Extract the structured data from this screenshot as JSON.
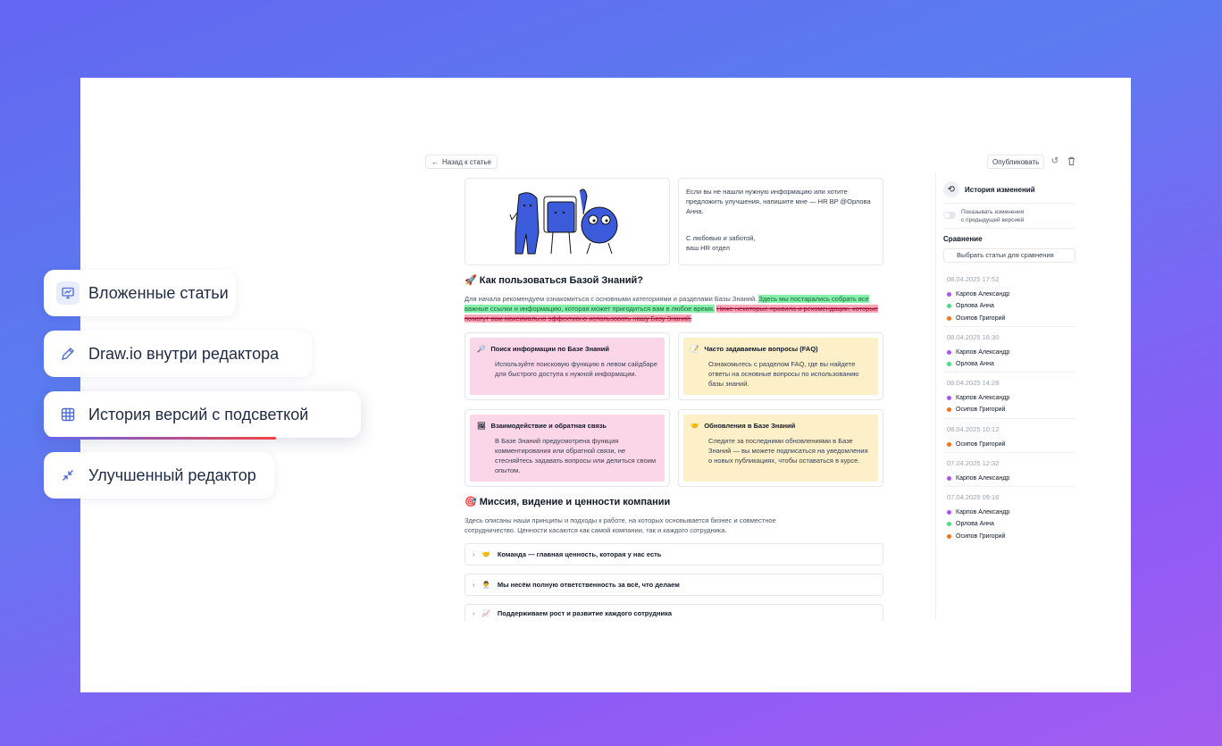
{
  "features": [
    {
      "label": "Вложенные статьи",
      "icon": "presentation-chart-icon"
    },
    {
      "label": "Draw.io внутри редактора",
      "icon": "pencil-icon"
    },
    {
      "label": "История версий с подсветкой",
      "icon": "grid-icon"
    },
    {
      "label": "Улучшенный редактор",
      "icon": "arrows-collapse-icon"
    }
  ],
  "toolbar": {
    "back_label": "Назад к статье",
    "publish_label": "Опубликовать"
  },
  "intro_note": {
    "line1": "Если вы не нашли нужную информацию или хотите предложить улучшения, напишите мне — HR BP @Орлова Анна.",
    "line2": "С любовью и заботой,",
    "line3": "ваш HR отдел"
  },
  "section1": {
    "emoji": "🚀",
    "title": "Как пользоваться Базой Знаний?",
    "text_plain": "Для начала рекомендуем ознакомиться с основными категориями и разделами Базы Знаний.",
    "text_added": "Здесь мы постарались собрать все важные ссылки и информацию, которая может пригодиться вам в любое время.",
    "text_removed": "Ниже некоторые правила и рекомендации, которые помогут вам максимально эффективно использовать нашу Базу Знаний."
  },
  "cards": [
    {
      "emoji": "🔎",
      "title": "Поиск информации по Базе Знаний",
      "body": "Используйте поисковую функцию в левом сайдбаре для быстрого доступа к нужной информации."
    },
    {
      "emoji": "📝",
      "title": "Часто задаваемые вопросы (FAQ)",
      "body": "Ознакомьтесь с разделом FAQ, где вы найдете ответы на основные вопросы по использованию базы знаний."
    },
    {
      "emoji": "🖼",
      "title": "Взаимодействие и обратная связь",
      "body": "В Базе Знаний предусмотрена функция комментирования или обратной связи, не стесняйтесь задавать вопросы или делиться своим опытом."
    },
    {
      "emoji": "🤝",
      "title": "Обновления в Базе Знаний",
      "body": "Следите за последними обновлениями в Базе Знаний — вы можете подписаться на уведомления о новых публикациях, чтобы оставаться в курсе."
    }
  ],
  "section2": {
    "emoji": "🎯",
    "title": "Миссия, видение и ценности компании",
    "text": "Здесь описаны наши принципы и подходы к работе, на которых основывается бизнес и совместное сотрудничество. Ценности касаются как самой компании, так и каждого сотрудника."
  },
  "accordions": [
    {
      "emoji": "🤝",
      "label": "Команда — главная ценность, которая у нас есть"
    },
    {
      "emoji": "👨‍💼",
      "label": "Мы несём полную ответственность за всё, что делаем"
    },
    {
      "emoji": "📈",
      "label": "Поддерживаем рост и развитие каждого сотрудника"
    }
  ],
  "history": {
    "title": "История изменений",
    "toggle_label_1": "Показывать изменения",
    "toggle_label_2": "с предыдущей версией",
    "compare_label": "Сравнение",
    "compare_select": "Выбрать статьи для сравнения",
    "colors": {
      "purple": "#a855f7",
      "green": "#4ade80",
      "orange": "#f97316"
    },
    "versions": [
      {
        "date": "08.04.2025 17:52",
        "authors": [
          {
            "name": "Карпов Александр",
            "color": "#a855f7"
          },
          {
            "name": "Орлова Анна",
            "color": "#4ade80"
          },
          {
            "name": "Осипов Григорий",
            "color": "#f97316"
          }
        ]
      },
      {
        "date": "08.04.2025 16:30",
        "authors": [
          {
            "name": "Карпов Александр",
            "color": "#a855f7"
          },
          {
            "name": "Орлова Анна",
            "color": "#4ade80"
          }
        ]
      },
      {
        "date": "08.04.2025 14:28",
        "authors": [
          {
            "name": "Карпов Александр",
            "color": "#a855f7"
          },
          {
            "name": "Осипов Григорий",
            "color": "#f97316"
          }
        ]
      },
      {
        "date": "08.04.2025 10:12",
        "authors": [
          {
            "name": "Осипов Григорий",
            "color": "#f97316"
          }
        ]
      },
      {
        "date": "07.04.2025 12:32",
        "authors": [
          {
            "name": "Карпов Александр",
            "color": "#a855f7"
          }
        ]
      },
      {
        "date": "07.04.2025 09:16",
        "authors": [
          {
            "name": "Карпов Александр",
            "color": "#a855f7"
          },
          {
            "name": "Орлова Анна",
            "color": "#4ade80"
          },
          {
            "name": "Осипов Григорий",
            "color": "#f97316"
          }
        ]
      }
    ]
  }
}
